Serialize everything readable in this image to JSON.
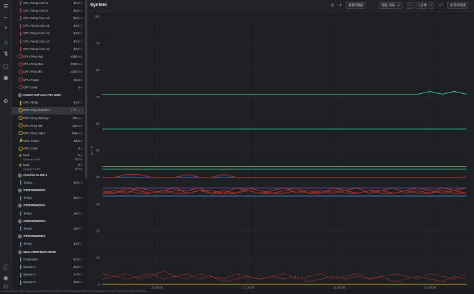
{
  "nav_icons": [
    "menu-icon",
    "back-icon",
    "add-icon",
    "home-icon",
    "sensors-icon",
    "bookmark-icon",
    "layers-icon",
    "settings-icon",
    "info-icon",
    "user-icon",
    "account-icon"
  ],
  "sidebar": {
    "rows": [
      {
        "kind": "item",
        "icon": "therm",
        "label": "CPU Temp Core 8",
        "value": "34.0",
        "unit": "°C"
      },
      {
        "kind": "item",
        "icon": "therm",
        "label": "CPU Temp Core 9",
        "value": "34.0",
        "unit": "°C"
      },
      {
        "kind": "item",
        "icon": "therm",
        "label": "CPU Temp Core 10",
        "value": "35.0",
        "unit": "°C"
      },
      {
        "kind": "item",
        "icon": "therm",
        "label": "CPU Temp Core 11",
        "value": "34.0",
        "unit": "°C"
      },
      {
        "kind": "item",
        "icon": "therm",
        "label": "CPU Temp Core 12",
        "value": "34.0",
        "unit": "°C"
      },
      {
        "kind": "item",
        "icon": "therm",
        "label": "CPU Temp Core 13",
        "value": "34.0",
        "unit": "°C"
      },
      {
        "kind": "item",
        "icon": "therm",
        "label": "CPU Temp Core 14",
        "value": "34.0",
        "unit": "°C"
      },
      {
        "kind": "item",
        "icon": "gauge",
        "label": "CPU Freq Avg",
        "value": "1394",
        "unit": "MHz"
      },
      {
        "kind": "item",
        "icon": "gauge",
        "label": "CPU Freq Max",
        "value": "2200",
        "unit": "MHz"
      },
      {
        "kind": "item",
        "icon": "gauge",
        "label": "CPU Freq Min",
        "value": "1200",
        "unit": "MHz"
      },
      {
        "kind": "item",
        "icon": "gauge",
        "label": "CPU Power",
        "value": "21.0",
        "unit": "W"
      },
      {
        "kind": "item",
        "icon": "gauge",
        "label": "CPU Load",
        "value": "4",
        "unit": "%"
      },
      {
        "kind": "header",
        "label": "NVIDIA GeForce RTX 3090"
      },
      {
        "kind": "item",
        "icon": "thermy",
        "label": "GPU Temp",
        "value": "44.0",
        "unit": "°C"
      },
      {
        "kind": "item",
        "icon": "gaugey",
        "label": "GPU Freq Graphics",
        "value": "",
        "unit": "",
        "selected": true
      },
      {
        "kind": "item",
        "icon": "gaugey",
        "label": "GPU Freq Memory",
        "value": "405",
        "unit": "MHz"
      },
      {
        "kind": "item",
        "icon": "gaugey",
        "label": "GPU Freq SM",
        "value": "210",
        "unit": "MHz"
      },
      {
        "kind": "item",
        "icon": "gaugey",
        "label": "GPU Freq Video",
        "value": "555",
        "unit": "MHz"
      },
      {
        "kind": "item",
        "icon": "bolt",
        "label": "GPU Power",
        "value": "53.0",
        "unit": "W"
      },
      {
        "kind": "item",
        "icon": "gaugey",
        "label": "GPU Load",
        "value": "0",
        "unit": "%"
      },
      {
        "kind": "fan",
        "icon": "fan",
        "label": "fan1",
        "sub": "Default Profile",
        "value": "0",
        "unit": "%",
        "value2": "0",
        "unit2": "RPM"
      },
      {
        "kind": "fan",
        "icon": "fan",
        "label": "fan2",
        "sub": "Default Profile",
        "value": "0",
        "unit": "%",
        "value2": "0",
        "unit2": "RPM"
      },
      {
        "kind": "header",
        "label": "Colorful SL300 1"
      },
      {
        "kind": "item",
        "icon": "thermb",
        "label": "Temp1",
        "value": "40.0",
        "unit": "°C"
      },
      {
        "kind": "header",
        "label": "ST3000NM0023"
      },
      {
        "kind": "item",
        "icon": "thermb",
        "label": "Temp1",
        "value": "36.0",
        "unit": "°C"
      },
      {
        "kind": "header",
        "label": "ST3000NM0023"
      },
      {
        "kind": "item",
        "icon": "thermb",
        "label": "Temp1",
        "value": "29.0",
        "unit": "°C"
      },
      {
        "kind": "header",
        "label": "ST3000NM0023"
      },
      {
        "kind": "item",
        "icon": "thermb",
        "label": "Temp1",
        "value": "29.0",
        "unit": "°C"
      },
      {
        "kind": "header",
        "label": "ST3000NM0022"
      },
      {
        "kind": "item",
        "icon": "thermb",
        "label": "Temp1",
        "value": "33.0",
        "unit": "°C"
      },
      {
        "kind": "header",
        "label": "MZ7LH960HBJR-00005"
      },
      {
        "kind": "item",
        "icon": "thermg",
        "label": "Composite",
        "value": "42.9",
        "unit": "°C"
      },
      {
        "kind": "item",
        "icon": "thermg",
        "label": "Sensor 1",
        "value": "42.9",
        "unit": "°C"
      },
      {
        "kind": "item",
        "icon": "thermg",
        "label": "Sensor 2",
        "value": "17.9",
        "unit": "°C"
      },
      {
        "kind": "item",
        "icon": "thermg",
        "label": "Sensor 3",
        "value": "20.9",
        "unit": "°C"
      }
    ]
  },
  "header": {
    "title": "System",
    "sensors_button": "查看传感器",
    "settings_button": "温度, 风扇...",
    "time_window": "1 分钟",
    "timeline_button": "时间范围"
  },
  "colors": {
    "accent": "#3ddc97",
    "red": "#c0392b",
    "bg": "#1d1f23"
  },
  "status_bar": "content.html?1.082/?/dashboard/subj/0037/dash000FF5b44e0b80/4f1f002?a7d82d/ead572a8?e83?1d1/d3a27b3bed687f66a...",
  "chart_data": {
    "type": "line",
    "title": "System",
    "ylabel": "%  /  °C",
    "ylim": [
      0,
      100
    ],
    "yticks": [
      0,
      10,
      20,
      30,
      40,
      50,
      60,
      70,
      80,
      90,
      100
    ],
    "xlim": [
      0,
      60
    ],
    "xticks": [
      {
        "t": 9,
        "label": "11:18:00"
      },
      {
        "t": 24,
        "label": "11:18:15"
      },
      {
        "t": 39,
        "label": "11:18:30"
      },
      {
        "t": 54,
        "label": "11:18:45"
      }
    ],
    "x": [
      0,
      2,
      4,
      6,
      8,
      10,
      12,
      14,
      16,
      18,
      20,
      22,
      24,
      26,
      28,
      30,
      32,
      34,
      36,
      38,
      40,
      42,
      44,
      46,
      48,
      50,
      52,
      54,
      56,
      58,
      60
    ],
    "series": [
      {
        "color": "#3ddc97",
        "style": "solid",
        "values": [
          71,
          71,
          71,
          71,
          71,
          71,
          71,
          71,
          71,
          71,
          71,
          71,
          71,
          71,
          71,
          71,
          71,
          71,
          71,
          71,
          71,
          71,
          71,
          71,
          71,
          71,
          71,
          72,
          71,
          72,
          71
        ]
      },
      {
        "color": "#3ddc97",
        "style": "solid",
        "values": [
          58,
          58,
          58,
          58,
          58,
          58,
          58,
          58,
          58,
          58,
          58,
          58,
          58,
          58,
          58,
          58,
          58,
          58,
          58,
          58,
          58,
          58,
          58,
          58,
          58,
          58,
          58,
          58,
          58,
          58,
          58
        ]
      },
      {
        "color": "#d8d0a8",
        "style": "solid",
        "values": [
          44,
          44,
          44,
          44,
          44,
          44,
          44,
          44,
          44,
          44,
          44,
          44,
          44,
          44,
          44,
          44,
          44,
          44,
          44,
          44,
          44,
          44,
          44,
          44,
          44,
          44,
          44,
          44,
          44,
          44,
          44
        ]
      },
      {
        "color": "#3ddc97",
        "style": "solid",
        "values": [
          43,
          43,
          43,
          43,
          43,
          43,
          43,
          43,
          43,
          43,
          43,
          43,
          43,
          43,
          43,
          43,
          43,
          43,
          43,
          43,
          43,
          43,
          43,
          43,
          43,
          43,
          43,
          43,
          43,
          43,
          43
        ]
      },
      {
        "color": "#4a7fd0",
        "style": "solid",
        "values": [
          40,
          40,
          40,
          40,
          40,
          40,
          40,
          40,
          40,
          40,
          40,
          40,
          40,
          40,
          40,
          40,
          40,
          40,
          40,
          40,
          40,
          40,
          40,
          40,
          40,
          40,
          40,
          40,
          40,
          40,
          40
        ]
      },
      {
        "color": "#c0392b",
        "style": "solid",
        "values": [
          40,
          40,
          41,
          41,
          40,
          40,
          40,
          41,
          40,
          40,
          41,
          40,
          40,
          40,
          40,
          40,
          40,
          40,
          40,
          40,
          40,
          40,
          40,
          40,
          40,
          40,
          40,
          40,
          40,
          40,
          40
        ]
      },
      {
        "color": "#7a4fc8",
        "style": "solid",
        "values": [
          36,
          36,
          36,
          36,
          36,
          36,
          36,
          36,
          36,
          36,
          36,
          36,
          36,
          36,
          36,
          36,
          36,
          36,
          36,
          36,
          36,
          36,
          36,
          36,
          36,
          36,
          36,
          36,
          36,
          36,
          36
        ]
      },
      {
        "color": "#c0392b",
        "style": "solid",
        "values": [
          35,
          34,
          36,
          35,
          34,
          35,
          36,
          34,
          35,
          35,
          34,
          36,
          35,
          34,
          35,
          36,
          34,
          35,
          34,
          36,
          35,
          34,
          35,
          35,
          36,
          34,
          35,
          34,
          36,
          35,
          34
        ]
      },
      {
        "color": "#c0392b",
        "style": "solid",
        "values": [
          34,
          35,
          34,
          36,
          35,
          34,
          35,
          35,
          36,
          34,
          35,
          34,
          36,
          35,
          34,
          35,
          36,
          34,
          35,
          34,
          35,
          36,
          34,
          35,
          34,
          35,
          36,
          35,
          34,
          35,
          36
        ]
      },
      {
        "color": "#c0392b",
        "style": "solid",
        "values": [
          34,
          34,
          35,
          34,
          34,
          35,
          34,
          34,
          35,
          34,
          34,
          34,
          35,
          34,
          34,
          34,
          35,
          34,
          34,
          35,
          34,
          34,
          35,
          34,
          34,
          35,
          34,
          34,
          35,
          34,
          34
        ]
      },
      {
        "color": "#4a7fd0",
        "style": "solid",
        "values": [
          33,
          33,
          33,
          33,
          33,
          33,
          33,
          33,
          33,
          33,
          33,
          33,
          33,
          33,
          33,
          33,
          33,
          33,
          33,
          33,
          33,
          33,
          33,
          33,
          33,
          33,
          33,
          33,
          33,
          33,
          33
        ]
      },
      {
        "color": "#c0392b",
        "style": "dashed",
        "values": [
          4,
          3,
          4,
          2,
          3,
          5,
          3,
          2,
          4,
          3,
          2,
          4,
          3,
          2,
          3,
          4,
          2,
          3,
          4,
          2,
          3,
          4,
          2,
          3,
          4,
          3,
          2,
          4,
          3,
          2,
          4
        ]
      },
      {
        "color": "#c0392b",
        "style": "dashed",
        "values": [
          2,
          3,
          2,
          3,
          4,
          2,
          3,
          4,
          2,
          3,
          1,
          2,
          3,
          2,
          3,
          2,
          3,
          1,
          2,
          3,
          2,
          3,
          2,
          3,
          1,
          2,
          3,
          2,
          1,
          3,
          2
        ]
      },
      {
        "color": "#d8b030",
        "style": "solid",
        "values": [
          0,
          0,
          0,
          0,
          0,
          0,
          0,
          0,
          0,
          0,
          0,
          0,
          0,
          0,
          0,
          0,
          0,
          0,
          0,
          0,
          0,
          0,
          0,
          0,
          0,
          0,
          0,
          0,
          0,
          0,
          0
        ]
      }
    ]
  }
}
